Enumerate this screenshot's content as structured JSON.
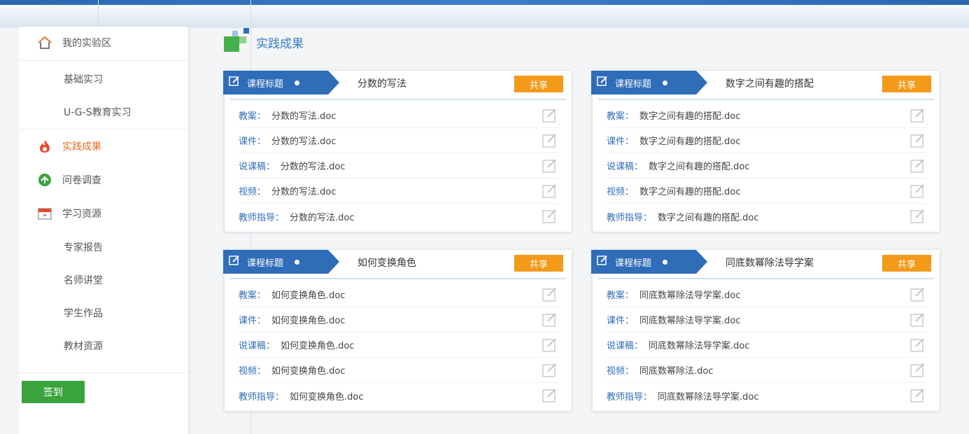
{
  "sidebar": {
    "my_lab": "我的实验区",
    "basic_practice": "基础实习",
    "ugs_practice": "U-G-S教育实习",
    "practice_results": "实践成果",
    "survey": "问卷调查",
    "learning_resources": "学习资源",
    "expert_reports": "专家报告",
    "famous_teacher": "名师讲堂",
    "student_works": "学生作品",
    "textbook_resources": "教材资源",
    "sign_in": "签到"
  },
  "main": {
    "section_title": "实践成果",
    "cards": [
      {
        "tag": "课程标题",
        "title": "分数的写法",
        "share": "共享",
        "rows": [
          {
            "label": "教案：",
            "file": "分数的写法.doc"
          },
          {
            "label": "课件：",
            "file": "分数的写法.doc"
          },
          {
            "label": "说课稿：",
            "file": "分数的写法.doc"
          },
          {
            "label": "视频：",
            "file": "分数的写法.doc"
          },
          {
            "label": "教师指导：",
            "file": "分数的写法.doc"
          }
        ]
      },
      {
        "tag": "课程标题",
        "title": "数字之间有趣的搭配",
        "share": "共享",
        "rows": [
          {
            "label": "教案：",
            "file": "数字之间有趣的搭配.doc"
          },
          {
            "label": "课件：",
            "file": "数字之间有趣的搭配.doc"
          },
          {
            "label": "说课稿：",
            "file": "数字之间有趣的搭配.doc"
          },
          {
            "label": "视频：",
            "file": "数字之间有趣的搭配.doc"
          },
          {
            "label": "教师指导：",
            "file": "数字之间有趣的搭配.doc"
          }
        ]
      },
      {
        "tag": "课程标题",
        "title": "如何变换角色",
        "share": "共享",
        "rows": [
          {
            "label": "教案：",
            "file": "如何变换角色.doc"
          },
          {
            "label": "课件：",
            "file": "如何变换角色.doc"
          },
          {
            "label": "说课稿：",
            "file": "如何变换角色.doc"
          },
          {
            "label": "视频：",
            "file": "如何变换角色.doc"
          },
          {
            "label": "教师指导：",
            "file": "如何变换角色.doc"
          }
        ]
      },
      {
        "tag": "课程标题",
        "title": "同底数幂除法导学案",
        "share": "共享",
        "rows": [
          {
            "label": "教案：",
            "file": "同底数幂除法导学案.doc"
          },
          {
            "label": "课件：",
            "file": "同底数幂除法导学案.doc"
          },
          {
            "label": "说课稿：",
            "file": "同底数幂除法导学案.doc"
          },
          {
            "label": "视频：",
            "file": "同底数幂除法.doc"
          },
          {
            "label": "教师指导：",
            "file": "同底数幂除法导学案.doc"
          }
        ]
      }
    ]
  },
  "colors": {
    "primary_blue": "#2f6db8",
    "share_orange": "#f39a1a",
    "active_orange": "#e86a1f",
    "sign_green": "#3ba33b"
  },
  "icons": {
    "sidebar_home": "home-icon",
    "sidebar_results": "flame-icon",
    "sidebar_survey": "survey-icon",
    "sidebar_resources": "calendar-icon",
    "card_tag": "edit-icon",
    "row_action": "edit-icon"
  }
}
